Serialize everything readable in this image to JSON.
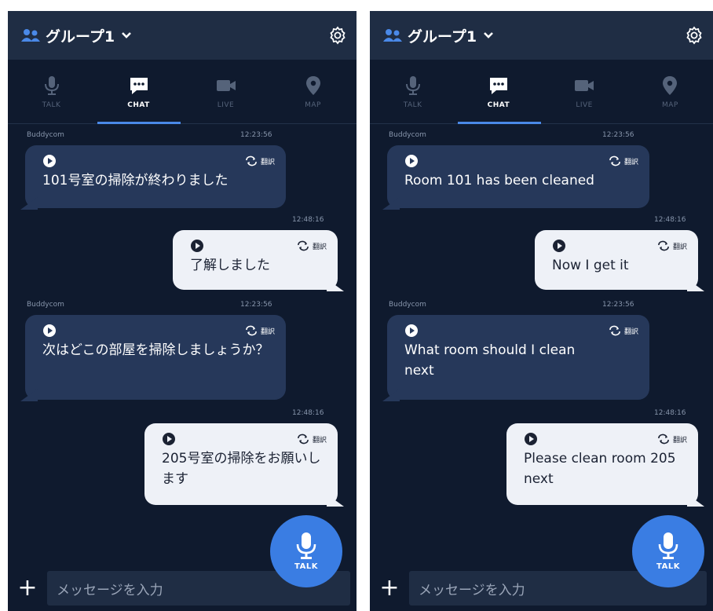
{
  "screens": [
    {
      "header": {
        "group_name": "グループ1"
      },
      "tabs": [
        {
          "label": "TALK",
          "icon": "mic-icon"
        },
        {
          "label": "CHAT",
          "icon": "chat-icon",
          "active": true
        },
        {
          "label": "LIVE",
          "icon": "video-camera-icon"
        },
        {
          "label": "MAP",
          "icon": "map-pin-icon"
        }
      ],
      "messages": [
        {
          "direction": "incoming",
          "sender": "Buddycom",
          "time": "12:23:56",
          "translate_label": "翻訳",
          "text": "101号室の掃除が終わりました"
        },
        {
          "direction": "outgoing",
          "time": "12:48:16",
          "translate_label": "翻訳",
          "text": "了解しました"
        },
        {
          "direction": "incoming",
          "sender": "Buddycom",
          "time": "12:23:56",
          "translate_label": "翻訳",
          "text": "次はどこの部屋を掃除しましょうか？"
        },
        {
          "direction": "outgoing",
          "time": "12:48:16",
          "translate_label": "翻訳",
          "text": "205号室の掃除をお願いします"
        }
      ],
      "input": {
        "placeholder": "メッセージを入力"
      },
      "talk_button": {
        "label": "TALK"
      }
    },
    {
      "header": {
        "group_name": "グループ1"
      },
      "tabs": [
        {
          "label": "TALK",
          "icon": "mic-icon"
        },
        {
          "label": "CHAT",
          "icon": "chat-icon",
          "active": true
        },
        {
          "label": "LIVE",
          "icon": "video-camera-icon"
        },
        {
          "label": "MAP",
          "icon": "map-pin-icon"
        }
      ],
      "messages": [
        {
          "direction": "incoming",
          "sender": "Buddycom",
          "time": "12:23:56",
          "translate_label": "翻訳",
          "text": "Room 101 has been cleaned"
        },
        {
          "direction": "outgoing",
          "time": "12:48:16",
          "translate_label": "翻訳",
          "text": "Now I get it"
        },
        {
          "direction": "incoming",
          "sender": "Buddycom",
          "time": "12:23:56",
          "translate_label": "翻訳",
          "text": "What room should I clean next"
        },
        {
          "direction": "outgoing",
          "time": "12:48:16",
          "translate_label": "翻訳",
          "text": "Please clean room 205 next"
        }
      ],
      "input": {
        "placeholder": "メッセージを入力"
      },
      "talk_button": {
        "label": "TALK"
      }
    }
  ],
  "colors": {
    "background": "#0f1a2e",
    "header": "#1f2d44",
    "incoming_bubble": "#26385a",
    "outgoing_bubble": "#eef1f7",
    "accent": "#3a7de3"
  }
}
